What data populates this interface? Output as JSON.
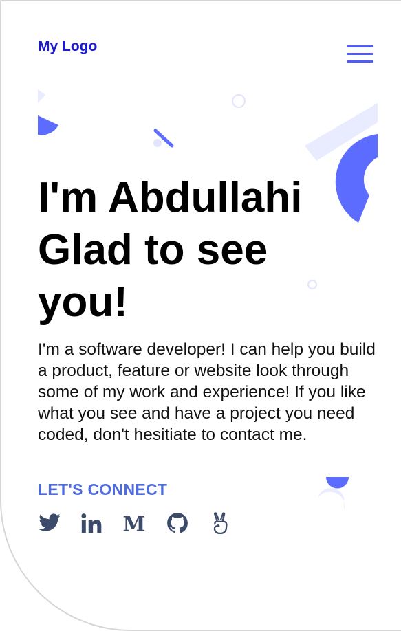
{
  "header": {
    "logo_text": "My Logo",
    "menu_icon": "hamburger-menu-icon"
  },
  "hero": {
    "title_line1": "I'm Abdullahi",
    "title_line2": "Glad to see",
    "title_line3": "you!",
    "intro": "I'm a software developer! I can help you build a product, feature or website look through some of my work and experience! If you like what you see and have a project you need coded, don't hesitiate to contact me.",
    "connect_label": "LET'S CONNECT"
  },
  "socials": [
    {
      "name": "twitter",
      "icon": "twitter-icon"
    },
    {
      "name": "linkedin",
      "icon": "linkedin-icon"
    },
    {
      "name": "medium",
      "icon": "medium-icon"
    },
    {
      "name": "github",
      "icon": "github-icon"
    },
    {
      "name": "angellist",
      "icon": "angellist-icon"
    }
  ],
  "colors": {
    "logo": "#1a1ad6",
    "accent": "#4d5bff",
    "connect": "#4f6be0",
    "icons": "#3d4b6b",
    "deco_light": "#e9ebff",
    "deco_dark": "#5c6cff"
  }
}
